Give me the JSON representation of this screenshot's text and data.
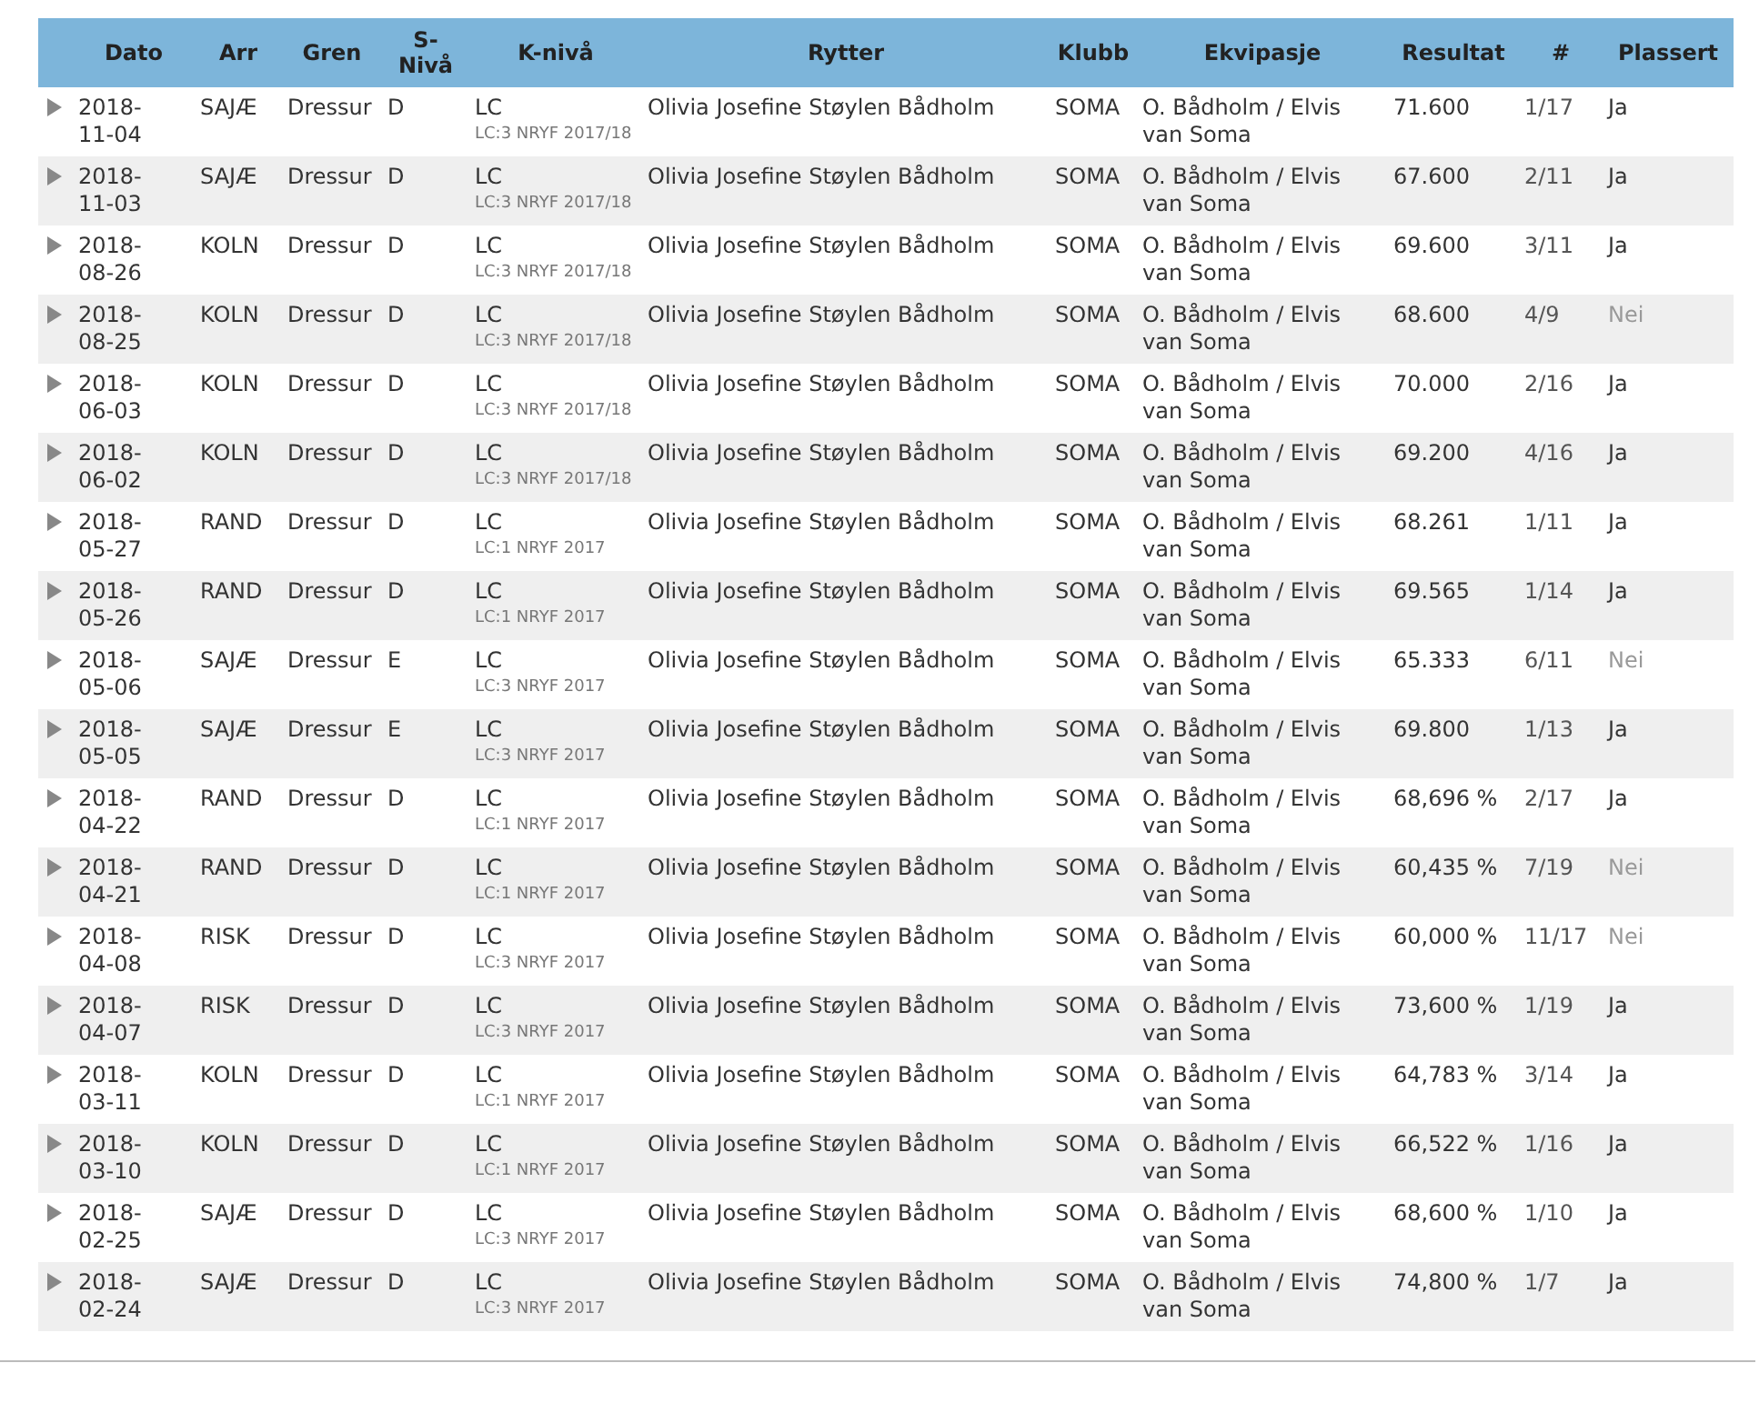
{
  "table": {
    "columns": [
      "Dato",
      "Arr",
      "Gren",
      "S-\nNivå",
      "K-nivå",
      "Rytter",
      "Klubb",
      "Ekvipasje",
      "Resultat",
      "#",
      "Plassert"
    ],
    "rows": [
      {
        "date": "2018-\n11-04",
        "arr": "SAJÆ",
        "gren": "Dressur",
        "s_niva": "D",
        "k_niva": "LC",
        "k_niva_detail": "LC:3 NRYF 2017/18",
        "rytter": "Olivia Josefine Støylen Bådholm",
        "klubb": "SOMA",
        "ekvipasje": "O. Bådholm / Elvis van Soma",
        "resultat": "71.600",
        "rank": "1/17",
        "plassert": "Ja",
        "placed": true
      },
      {
        "date": "2018-\n11-03",
        "arr": "SAJÆ",
        "gren": "Dressur",
        "s_niva": "D",
        "k_niva": "LC",
        "k_niva_detail": "LC:3 NRYF 2017/18",
        "rytter": "Olivia Josefine Støylen Bådholm",
        "klubb": "SOMA",
        "ekvipasje": "O. Bådholm / Elvis van Soma",
        "resultat": "67.600",
        "rank": "2/11",
        "plassert": "Ja",
        "placed": true
      },
      {
        "date": "2018-\n08-26",
        "arr": "KOLN",
        "gren": "Dressur",
        "s_niva": "D",
        "k_niva": "LC",
        "k_niva_detail": "LC:3 NRYF 2017/18",
        "rytter": "Olivia Josefine Støylen Bådholm",
        "klubb": "SOMA",
        "ekvipasje": "O. Bådholm / Elvis van Soma",
        "resultat": "69.600",
        "rank": "3/11",
        "plassert": "Ja",
        "placed": true
      },
      {
        "date": "2018-\n08-25",
        "arr": "KOLN",
        "gren": "Dressur",
        "s_niva": "D",
        "k_niva": "LC",
        "k_niva_detail": "LC:3 NRYF 2017/18",
        "rytter": "Olivia Josefine Støylen Bådholm",
        "klubb": "SOMA",
        "ekvipasje": "O. Bådholm / Elvis van Soma",
        "resultat": "68.600",
        "rank": "4/9",
        "plassert": "Nei",
        "placed": false
      },
      {
        "date": "2018-\n06-03",
        "arr": "KOLN",
        "gren": "Dressur",
        "s_niva": "D",
        "k_niva": "LC",
        "k_niva_detail": "LC:3 NRYF 2017/18",
        "rytter": "Olivia Josefine Støylen Bådholm",
        "klubb": "SOMA",
        "ekvipasje": "O. Bådholm / Elvis van Soma",
        "resultat": "70.000",
        "rank": "2/16",
        "plassert": "Ja",
        "placed": true
      },
      {
        "date": "2018-\n06-02",
        "arr": "KOLN",
        "gren": "Dressur",
        "s_niva": "D",
        "k_niva": "LC",
        "k_niva_detail": "LC:3 NRYF 2017/18",
        "rytter": "Olivia Josefine Støylen Bådholm",
        "klubb": "SOMA",
        "ekvipasje": "O. Bådholm / Elvis van Soma",
        "resultat": "69.200",
        "rank": "4/16",
        "plassert": "Ja",
        "placed": true
      },
      {
        "date": "2018-\n05-27",
        "arr": "RAND",
        "gren": "Dressur",
        "s_niva": "D",
        "k_niva": "LC",
        "k_niva_detail": "LC:1 NRYF 2017",
        "rytter": "Olivia Josefine Støylen Bådholm",
        "klubb": "SOMA",
        "ekvipasje": "O. Bådholm / Elvis van Soma",
        "resultat": "68.261",
        "rank": "1/11",
        "plassert": "Ja",
        "placed": true
      },
      {
        "date": "2018-\n05-26",
        "arr": "RAND",
        "gren": "Dressur",
        "s_niva": "D",
        "k_niva": "LC",
        "k_niva_detail": "LC:1 NRYF 2017",
        "rytter": "Olivia Josefine Støylen Bådholm",
        "klubb": "SOMA",
        "ekvipasje": "O. Bådholm / Elvis van Soma",
        "resultat": "69.565",
        "rank": "1/14",
        "plassert": "Ja",
        "placed": true
      },
      {
        "date": "2018-\n05-06",
        "arr": "SAJÆ",
        "gren": "Dressur",
        "s_niva": "E",
        "k_niva": "LC",
        "k_niva_detail": "LC:3 NRYF 2017",
        "rytter": "Olivia Josefine Støylen Bådholm",
        "klubb": "SOMA",
        "ekvipasje": "O. Bådholm / Elvis van Soma",
        "resultat": "65.333",
        "rank": "6/11",
        "plassert": "Nei",
        "placed": false
      },
      {
        "date": "2018-\n05-05",
        "arr": "SAJÆ",
        "gren": "Dressur",
        "s_niva": "E",
        "k_niva": "LC",
        "k_niva_detail": "LC:3 NRYF 2017",
        "rytter": "Olivia Josefine Støylen Bådholm",
        "klubb": "SOMA",
        "ekvipasje": "O. Bådholm / Elvis van Soma",
        "resultat": "69.800",
        "rank": "1/13",
        "plassert": "Ja",
        "placed": true
      },
      {
        "date": "2018-\n04-22",
        "arr": "RAND",
        "gren": "Dressur",
        "s_niva": "D",
        "k_niva": "LC",
        "k_niva_detail": "LC:1 NRYF 2017",
        "rytter": "Olivia Josefine Støylen Bådholm",
        "klubb": "SOMA",
        "ekvipasje": "O. Bådholm / Elvis van Soma",
        "resultat": "68,696 %",
        "rank": "2/17",
        "plassert": "Ja",
        "placed": true
      },
      {
        "date": "2018-\n04-21",
        "arr": "RAND",
        "gren": "Dressur",
        "s_niva": "D",
        "k_niva": "LC",
        "k_niva_detail": "LC:1 NRYF 2017",
        "rytter": "Olivia Josefine Støylen Bådholm",
        "klubb": "SOMA",
        "ekvipasje": "O. Bådholm / Elvis van Soma",
        "resultat": "60,435 %",
        "rank": "7/19",
        "plassert": "Nei",
        "placed": false
      },
      {
        "date": "2018-\n04-08",
        "arr": "RISK",
        "gren": "Dressur",
        "s_niva": "D",
        "k_niva": "LC",
        "k_niva_detail": "LC:3 NRYF 2017",
        "rytter": "Olivia Josefine Støylen Bådholm",
        "klubb": "SOMA",
        "ekvipasje": "O. Bådholm / Elvis van Soma",
        "resultat": "60,000 %",
        "rank": "11/17",
        "plassert": "Nei",
        "placed": false
      },
      {
        "date": "2018-\n04-07",
        "arr": "RISK",
        "gren": "Dressur",
        "s_niva": "D",
        "k_niva": "LC",
        "k_niva_detail": "LC:3 NRYF 2017",
        "rytter": "Olivia Josefine Støylen Bådholm",
        "klubb": "SOMA",
        "ekvipasje": "O. Bådholm / Elvis van Soma",
        "resultat": "73,600 %",
        "rank": "1/19",
        "plassert": "Ja",
        "placed": true
      },
      {
        "date": "2018-\n03-11",
        "arr": "KOLN",
        "gren": "Dressur",
        "s_niva": "D",
        "k_niva": "LC",
        "k_niva_detail": "LC:1 NRYF 2017",
        "rytter": "Olivia Josefine Støylen Bådholm",
        "klubb": "SOMA",
        "ekvipasje": "O. Bådholm / Elvis van Soma",
        "resultat": "64,783 %",
        "rank": "3/14",
        "plassert": "Ja",
        "placed": true
      },
      {
        "date": "2018-\n03-10",
        "arr": "KOLN",
        "gren": "Dressur",
        "s_niva": "D",
        "k_niva": "LC",
        "k_niva_detail": "LC:1 NRYF 2017",
        "rytter": "Olivia Josefine Støylen Bådholm",
        "klubb": "SOMA",
        "ekvipasje": "O. Bådholm / Elvis van Soma",
        "resultat": "66,522 %",
        "rank": "1/16",
        "plassert": "Ja",
        "placed": true
      },
      {
        "date": "2018-\n02-25",
        "arr": "SAJÆ",
        "gren": "Dressur",
        "s_niva": "D",
        "k_niva": "LC",
        "k_niva_detail": "LC:3 NRYF 2017",
        "rytter": "Olivia Josefine Støylen Bådholm",
        "klubb": "SOMA",
        "ekvipasje": "O. Bådholm / Elvis van Soma",
        "resultat": "68,600 %",
        "rank": "1/10",
        "plassert": "Ja",
        "placed": true
      },
      {
        "date": "2018-\n02-24",
        "arr": "SAJÆ",
        "gren": "Dressur",
        "s_niva": "D",
        "k_niva": "LC",
        "k_niva_detail": "LC:3 NRYF 2017",
        "rytter": "Olivia Josefine Støylen Bådholm",
        "klubb": "SOMA",
        "ekvipasje": "O. Bådholm / Elvis van Soma",
        "resultat": "74,800 %",
        "rank": "1/7",
        "plassert": "Ja",
        "placed": true
      }
    ]
  }
}
